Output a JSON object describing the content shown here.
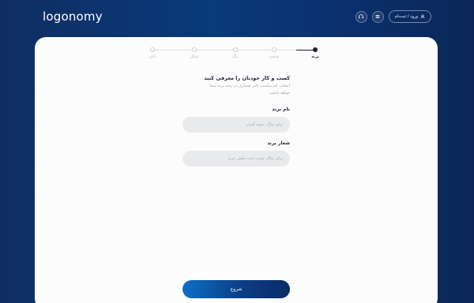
{
  "header": {
    "logo": "logonomy",
    "login_label": "ورود / ثبت‌نام"
  },
  "stepper": {
    "steps": [
      {
        "label": "برند",
        "active": true
      },
      {
        "label": "صنعت",
        "active": false
      },
      {
        "label": "رنگ",
        "active": false
      },
      {
        "label": "شکل",
        "active": false
      },
      {
        "label": "پایان",
        "active": false
      }
    ]
  },
  "form": {
    "title": "کسب و کار خودتان را معرفی کنید",
    "subtitle": "انتخاب نام مناسب تاثیر بسیاری در رشد برند شما خواهد داشت",
    "brand_name_label": "نام برند",
    "brand_name_placeholder": "برای مثال: سپید گستر",
    "slogan_label": "شعار برند",
    "slogan_placeholder": "برای مثال: تجربه لذت بخش خرید",
    "submit_label": "شروع"
  },
  "colors": {
    "background": "#0a3a7a",
    "card": "#fcfcfd",
    "accent": "#0d6fc4",
    "active_step": "#1a1f2e"
  }
}
